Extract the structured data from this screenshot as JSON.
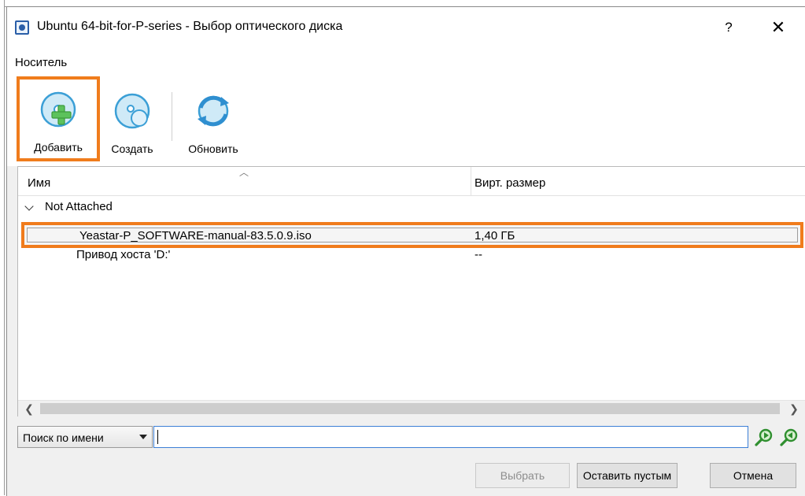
{
  "window": {
    "title": "Ubuntu 64-bit-for-P-series - Выбор оптического диска",
    "help_label": "?",
    "close_label": "✕"
  },
  "menu": {
    "media": "Носитель"
  },
  "toolbar": {
    "add": {
      "label": "Добавить",
      "icon": "add-disk-icon"
    },
    "create": {
      "label": "Создать",
      "icon": "create-disk-icon"
    },
    "refresh": {
      "label": "Обновить",
      "icon": "refresh-icon"
    }
  },
  "tree": {
    "columns": {
      "name": "Имя",
      "size": "Вирт. размер"
    },
    "group": {
      "label": "Not Attached"
    },
    "rows": [
      {
        "name": "Yeastar-P_SOFTWARE-manual-83.5.0.9.iso",
        "size": "1,40 ГБ"
      },
      {
        "name": "Привод хоста 'D:'",
        "size": "--"
      }
    ]
  },
  "search": {
    "mode_label": "Поиск по имени",
    "value": "",
    "prev_icon": "find-previous-icon",
    "next_icon": "find-next-icon"
  },
  "buttons": {
    "choose": "Выбрать",
    "leave_empty": "Оставить пустым",
    "cancel": "Отмена"
  },
  "colors": {
    "highlight": "#f07c1c",
    "accent": "#3c7fd6"
  }
}
